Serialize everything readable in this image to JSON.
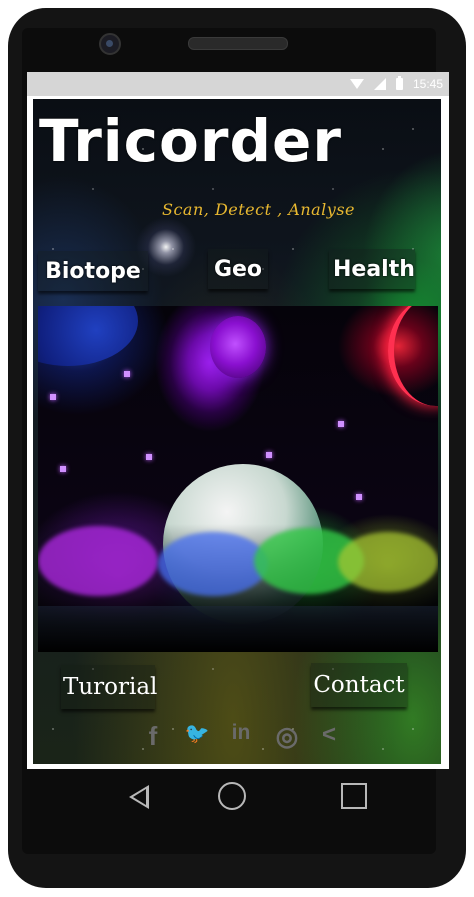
{
  "status_bar": {
    "time": "15:45"
  },
  "app": {
    "title": "Tricorder",
    "subtitle": "Scan, Detect , Analyse",
    "nav": {
      "biotope_label": "Biotope",
      "geo_label": "Geo",
      "health_label": "Health"
    },
    "bottom": {
      "tutorial_label": "Turorial",
      "contact_label": "Contact"
    },
    "social": {
      "facebook_glyph": "f",
      "twitter_glyph": "🐦",
      "linkedin_glyph": "in",
      "instagram_glyph": "◎",
      "share_glyph": "<"
    }
  },
  "colors": {
    "subtitle": "#e8b830",
    "social_icons": "#6a6a6a",
    "status_bar": "#d6d6d6"
  }
}
